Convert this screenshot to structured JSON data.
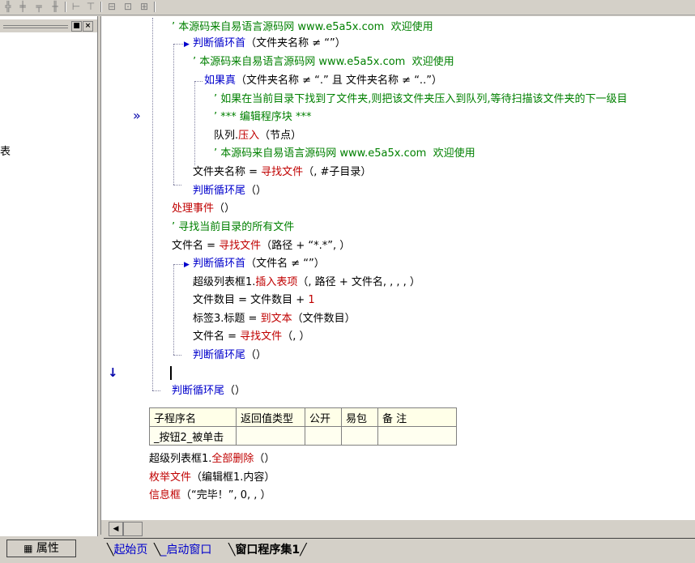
{
  "left_panel": {
    "close_label": "×",
    "min_label": "■",
    "visible_char": "表",
    "properties_button": "属性"
  },
  "code": {
    "l1": "’ 本源码来自易语言源码网 www.e5a5x.com  欢迎使用",
    "l2_kw": "判断循环首",
    "l2_rest": "（文件夹名称 ≠ “”）",
    "l3": "’ 本源码来自易语言源码网 www.e5a5x.com  欢迎使用",
    "l4_kw": "如果真",
    "l4_rest": "（文件夹名称 ≠ “.” 且 文件夹名称 ≠ “..”）",
    "l5": "’ 如果在当前目录下找到了文件夹,则把该文件夹压入到队列,等待扫描该文件夹的下一级目",
    "l6": "’ *** 编辑程序块 ***",
    "l7_obj": "队列.",
    "l7_fn": "压入",
    "l7_rest": "（节点）",
    "l8": "’ 本源码来自易语言源码网 www.e5a5x.com  欢迎使用",
    "l9_a": "文件夹名称 = ",
    "l9_fn": "寻找文件",
    "l9_b": "（, #子目录）",
    "l10_kw": "判断循环尾",
    "l10_rest": "（）",
    "l11_fn": "处理事件",
    "l11_rest": "（）",
    "l12": "’ 寻找当前目录的所有文件",
    "l13_a": "文件名 = ",
    "l13_fn": "寻找文件",
    "l13_b": "（路径 + “*.*”, ）",
    "l14_kw": "判断循环首",
    "l14_rest": "（文件名 ≠ “”）",
    "l15_a": "超级列表框1.",
    "l15_fn": "插入表项",
    "l15_b": "（, 路径 + 文件名, , , , ）",
    "l16_a": "文件数目 = 文件数目 + ",
    "l16_num": "1",
    "l17_a": "标签3.标题 = ",
    "l17_fn": "到文本",
    "l17_b": "（文件数目）",
    "l18_a": "文件名 = ",
    "l18_fn": "寻找文件",
    "l18_b": "（, ）",
    "l19_kw": "判断循环尾",
    "l19_rest": "（）",
    "l20_kw": "判断循环尾",
    "l20_rest": "（）"
  },
  "gutter": {
    "marker_arrow": "»",
    "marker_down": "↓"
  },
  "sub_table": {
    "headers": [
      "子程序名",
      "返回值类型",
      "公开",
      "易包",
      "备 注"
    ],
    "row": [
      "_按钮2_被单击",
      "",
      "",
      "",
      ""
    ]
  },
  "code2": {
    "m1_a": "超级列表框1.",
    "m1_fn": "全部删除",
    "m1_b": "（）",
    "m2_fn": "枚举文件",
    "m2_b": "（编辑框1.内容）",
    "m3_fn": "信息框",
    "m3_b": "（“完毕！”, 0, , ）"
  },
  "tabs": [
    "起始页",
    "_启动窗口",
    "窗口程序集1"
  ],
  "scroll": {
    "left_arrow": "◀"
  }
}
